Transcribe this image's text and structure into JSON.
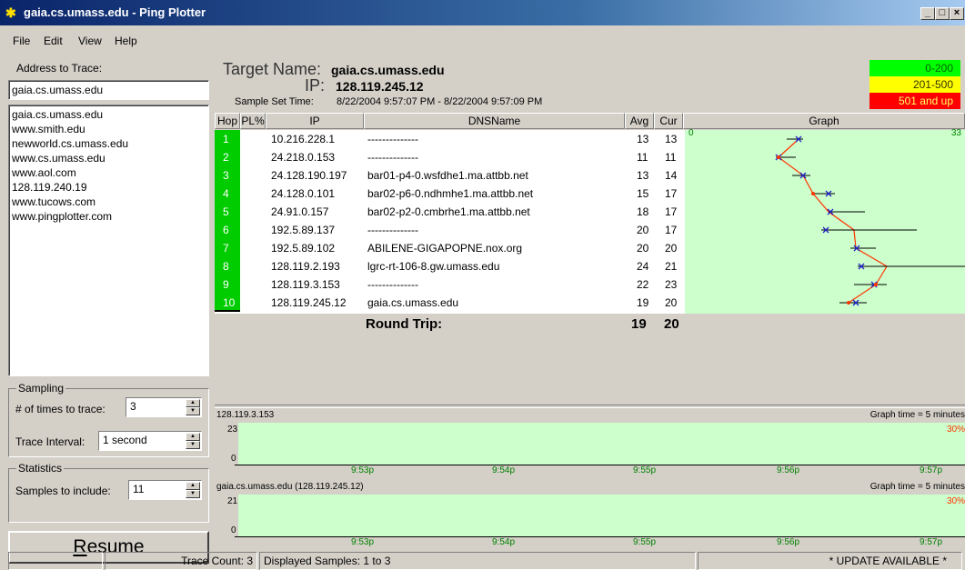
{
  "window": {
    "title": "gaia.cs.umass.edu - Ping Plotter",
    "min": "_",
    "max": "□",
    "close": "×"
  },
  "menu": [
    "File",
    "Edit",
    "View",
    "Help"
  ],
  "left": {
    "address_label": "Address to Trace:",
    "address_value": "gaia.cs.umass.edu",
    "history": [
      "gaia.cs.umass.edu",
      "www.smith.edu",
      "newworld.cs.umass.edu",
      "www.cs.umass.edu",
      "www.aol.com",
      "128.119.240.19",
      "www.tucows.com",
      "www.pingplotter.com"
    ],
    "sampling_label": "Sampling",
    "times_label": "# of times to trace:",
    "times_value": "3",
    "interval_label": "Trace Interval:",
    "interval_value": "1 second",
    "statistics_label": "Statistics",
    "samples_label": "Samples to include:",
    "samples_value": "11",
    "resume_label": "Resume"
  },
  "target": {
    "name_label": "Target Name:",
    "name_value": "gaia.cs.umass.edu",
    "ip_label": "IP:",
    "ip_value": "128.119.245.12",
    "time_label": "Sample Set Time:",
    "time_value": "8/22/2004 9:57:07 PM - 8/22/2004 9:57:09 PM"
  },
  "legend": [
    {
      "label": "0-200",
      "color": "#00ff00",
      "text": "#006600"
    },
    {
      "label": "201-500",
      "color": "#ffff00",
      "text": "#333300"
    },
    {
      "label": "501 and up",
      "color": "#ff0000",
      "text": "#ffff66"
    }
  ],
  "columns": {
    "hop": "Hop",
    "pl": "PL%",
    "ip": "IP",
    "dns": "DNSName",
    "avg": "Avg",
    "cur": "Cur",
    "graph": "Graph"
  },
  "graph_scale": {
    "min": "0",
    "max": "33"
  },
  "hops": [
    {
      "hop": "1",
      "ip": "10.216.228.1",
      "dns": "--------------",
      "avg": "13",
      "cur": "13"
    },
    {
      "hop": "2",
      "ip": "24.218.0.153",
      "dns": "--------------",
      "avg": "11",
      "cur": "11"
    },
    {
      "hop": "3",
      "ip": "24.128.190.197",
      "dns": "bar01-p4-0.wsfdhe1.ma.attbb.net",
      "avg": "13",
      "cur": "14"
    },
    {
      "hop": "4",
      "ip": "24.128.0.101",
      "dns": "bar02-p6-0.ndhmhe1.ma.attbb.net",
      "avg": "15",
      "cur": "17"
    },
    {
      "hop": "5",
      "ip": "24.91.0.157",
      "dns": "bar02-p2-0.cmbrhe1.ma.attbb.net",
      "avg": "18",
      "cur": "17"
    },
    {
      "hop": "6",
      "ip": "192.5.89.137",
      "dns": "--------------",
      "avg": "20",
      "cur": "17"
    },
    {
      "hop": "7",
      "ip": "192.5.89.102",
      "dns": "ABILENE-GIGAPOPNE.nox.org",
      "avg": "20",
      "cur": "20"
    },
    {
      "hop": "8",
      "ip": "128.119.2.193",
      "dns": "lgrc-rt-106-8.gw.umass.edu",
      "avg": "24",
      "cur": "21"
    },
    {
      "hop": "9",
      "ip": "128.119.3.153",
      "dns": "--------------",
      "avg": "22",
      "cur": "23"
    },
    {
      "hop": "10",
      "ip": "128.119.245.12",
      "dns": "gaia.cs.umass.edu",
      "avg": "19",
      "cur": "20"
    }
  ],
  "round_trip": {
    "label": "Round Trip:",
    "avg": "19",
    "cur": "20"
  },
  "detail1": {
    "title": "128.119.3.153",
    "graph_time": "Graph time = 5 minutes",
    "ymax": "23",
    "ymin": "0",
    "pct": "30%"
  },
  "detail2": {
    "title": "gaia.cs.umass.edu (128.119.245.12)",
    "graph_time": "Graph time = 5 minutes",
    "ymax": "21",
    "ymin": "0",
    "pct": "30%"
  },
  "time_ticks": [
    "9:53p",
    "9:54p",
    "9:55p",
    "9:56p",
    "9:57p"
  ],
  "status": {
    "blank": "",
    "trace_count": "Trace Count: 3",
    "displayed": "Displayed Samples: 1 to 3",
    "update": "* UPDATE AVAILABLE *"
  }
}
